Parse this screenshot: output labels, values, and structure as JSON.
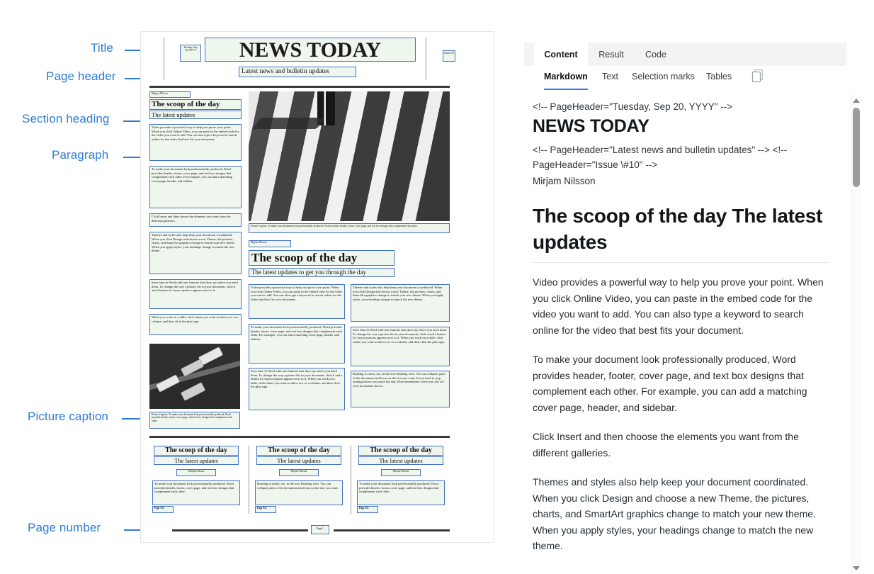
{
  "annotations": [
    {
      "label": "Title",
      "id": "title"
    },
    {
      "label": "Page header",
      "id": "page-header"
    },
    {
      "label": "Section heading",
      "id": "section-heading"
    },
    {
      "label": "Paragraph",
      "id": "paragraph"
    },
    {
      "label": "Picture caption",
      "id": "picture-caption"
    },
    {
      "label": "Page number",
      "id": "page-number"
    }
  ],
  "colors": {
    "annotation_blue": "#2E7CD6",
    "detection_box_outline": "#4472C4",
    "detection_box_fill": "#E2EEDE",
    "active_tab_underline": "#2E7CD6"
  },
  "document": {
    "header": {
      "date": "Tuesday, Sep 20, YYYY",
      "masthead": "NEWS TODAY",
      "subtitle": "Latest news and bulletin updates",
      "issue": "Issue #10"
    },
    "section1": {
      "author": "Mirjam Nilsson",
      "heading": "The scoop of the day",
      "subheading": "The latest updates",
      "paragraphs": [
        "Video provides a powerful way to help you prove your point. When you click Online Video, you can paste in the embed code for the video you want to add. You can also type a keyword to search online for the video that best fits your document.",
        "To make your document look professionally produced, Word provides header, footer, cover page, and text box designs that complement each other. For example, you can add a matching cover page, header, and sidebar.",
        "Click Insert and then choose the elements you want from the different galleries.",
        "Themes and styles also help keep your document coordinated. When you click Design and choose a new Theme, the pictures, charts, and SmartArt graphics change to match your new theme. When you apply styles, your headings change to match the new theme.",
        "Save time in Word with new buttons that show up where you need them. To change the way a picture fits in your document, click it and a button for layout options appears next to it.",
        "When you work on a table, click where you want to add a row or a column, and then click the plus sign."
      ],
      "picture_caption": "Picture Caption: To make your document look professionally produced, Word provides header, footer, cover page, and text box designs that complement each other."
    },
    "section2": {
      "author": "Mirjam Nilsson",
      "heading": "The scoop of the day",
      "subheading": "The latest updates to get you through the day",
      "left_column": [
        "Video provides a powerful way to help you prove your point. When you click Online Video, you can paste in the embed code for the video you want to add. You can also type a keyword to search online for the video that best fits your document.",
        "To make your document look professionally produced, Word provides header, footer, cover page, and text box designs that complement each other. For example, you can add a matching cover page, header, and sidebar.",
        "Save time in Word with new buttons that show up where you need them. To change the way a picture fits in your document, click it and a button for layout options appears next to it. When you work on a table, click where you want to add a row or a column, and then click the plus sign."
      ],
      "right_column": [
        "Themes and styles also help keep your document coordinated. When you click Design and choose a new Theme, the pictures, charts, and SmartArt graphics change to match your new theme. When you apply styles, your headings change to match the new theme.",
        "Save time in Word with new buttons that show up where you need them. To change the way a picture fits in your document, click it and a button for layout options appears next to it. When you work on a table, click where you want to add a row or a column, and then click the plus sign.",
        "Reading is easier, too, in the new Reading view. You can collapse parts of the document and focus on the text you want. If you need to stop reading before you reach the end, Word remembers where you left off - even on another device."
      ],
      "picture_caption": "Picture Caption: To make your document look professionally produced, Word provides header, footer, cover page, and text box designs that complement each other."
    },
    "bottom_columns": [
      {
        "heading": "The scoop of the day",
        "subheading": "The latest updates",
        "author": "Mirjam Nilsson",
        "body": "To make your document look professionally produced, Word provides header, footer, cover page, and text box designs that complement each other.",
        "page_label": "Page XX"
      },
      {
        "heading": "The scoop of the day",
        "subheading": "The latest updates",
        "author": "Mirjam Nilsson",
        "body": "Reading is easier, too, in the new Reading view. You can collapse parts of the document and focus on the text you want.",
        "page_label": "Page XX"
      },
      {
        "heading": "The scoop of the day",
        "subheading": "The latest updates",
        "author": "Mirjam Nilsson",
        "body": "To make your document look professionally produced, Word provides header, footer, cover page, and text box designs that complement each other.",
        "page_label": "Page XX"
      }
    ],
    "footer_page_number": "Page 1"
  },
  "panel": {
    "tabs": [
      {
        "label": "Content",
        "active": true
      },
      {
        "label": "Result",
        "active": false
      },
      {
        "label": "Code",
        "active": false
      }
    ],
    "subtabs": [
      {
        "label": "Markdown",
        "active": true
      },
      {
        "label": "Text",
        "active": false
      },
      {
        "label": "Selection marks",
        "active": false
      },
      {
        "label": "Tables",
        "active": false
      }
    ],
    "copy_icon": "copy-icon",
    "markdown": {
      "comment_1": "<!-- PageHeader=\"Tuesday, Sep 20, YYYY\" -->",
      "h1": "NEWS TODAY",
      "comment_2": "<!-- PageHeader=\"Latest news and bulletin updates\" --> <!-- PageHeader=\"Issue \\#10\" -->",
      "author": "Mirjam Nilsson",
      "h2": "The scoop of the day The latest updates",
      "paragraphs": [
        "Video provides a powerful way to help you prove your point. When you click Online Video, you can paste in the embed code for the video you want to add. You can also type a keyword to search online for the video that best fits your document.",
        "To make your document look professionally produced, Word provides header, footer, cover page, and text box designs that complement each other. For example, you can add a matching cover page, header, and sidebar.",
        "Click Insert and then choose the elements you want from the different galleries.",
        "Themes and styles also help keep your document coordinated. When you click Design and choose a new Theme, the pictures, charts, and SmartArt graphics change to match your new theme. When you apply styles, your headings change to match the new theme."
      ]
    },
    "scrollbar": {
      "up_icon": "caret-up-icon",
      "down_icon": "caret-down-icon"
    }
  }
}
